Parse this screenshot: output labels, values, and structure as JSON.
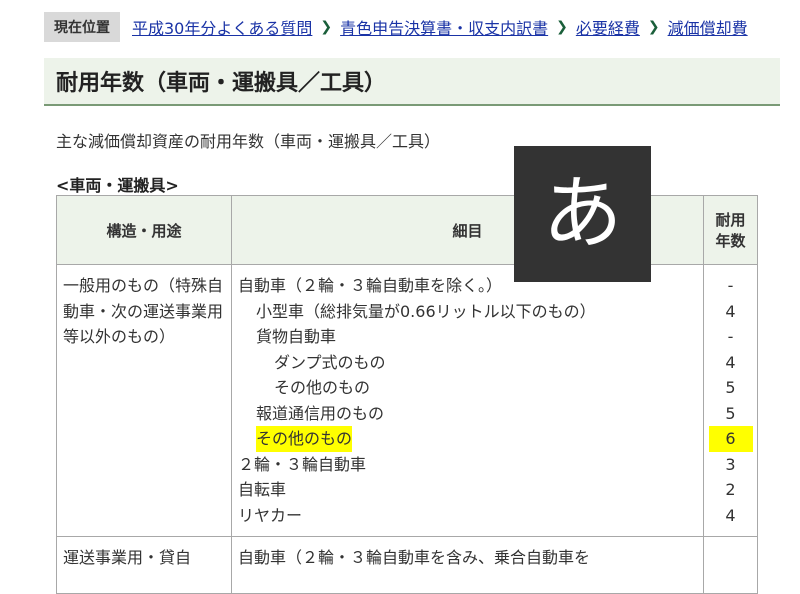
{
  "breadcrumb": {
    "label": "現在位置",
    "items": [
      "平成30年分よくある質問",
      "青色申告決算書・収支内訳書",
      "必要経費",
      "減価償却費"
    ]
  },
  "page_title": "耐用年数（車両・運搬具／工具）",
  "intro_text": "主な減価償却資産の耐用年数（車両・運搬具／工具）",
  "section_heading": "<車両・運搬具>",
  "table": {
    "headers": {
      "structure": "構造・用途",
      "detail": "細目",
      "years_line1": "耐用",
      "years_line2": "年数"
    },
    "row1": {
      "category": "一般用のもの（特殊自動車・次の運送事業用等以外のもの）",
      "details": [
        {
          "text": "自動車（２輪・３輪自動車を除く。）",
          "years": "-"
        },
        {
          "text": "小型車（総排気量が0.66リットル以下のもの）",
          "years": "4"
        },
        {
          "text": "貨物自動車",
          "years": "-"
        },
        {
          "text": "ダンプ式のもの",
          "years": "4"
        },
        {
          "text": "その他のもの",
          "years": "5"
        },
        {
          "text": "報道通信用のもの",
          "years": "5"
        },
        {
          "text": "その他のもの",
          "years": "6"
        },
        {
          "text": "２輪・３輪自動車",
          "years": "3"
        },
        {
          "text": "自転車",
          "years": "2"
        },
        {
          "text": "リヤカー",
          "years": "4"
        }
      ]
    },
    "row2": {
      "category": "運送事業用・貸自",
      "detail": "自動車（２輪・３輪自動車を含み、乗合自動車を"
    }
  },
  "ime_indicator": {
    "char": "あ"
  },
  "colors": {
    "link": "#1a33a6",
    "highlight": "#ffff00",
    "header_bg": "#edf3ea",
    "separator": "#1a5f3a"
  }
}
